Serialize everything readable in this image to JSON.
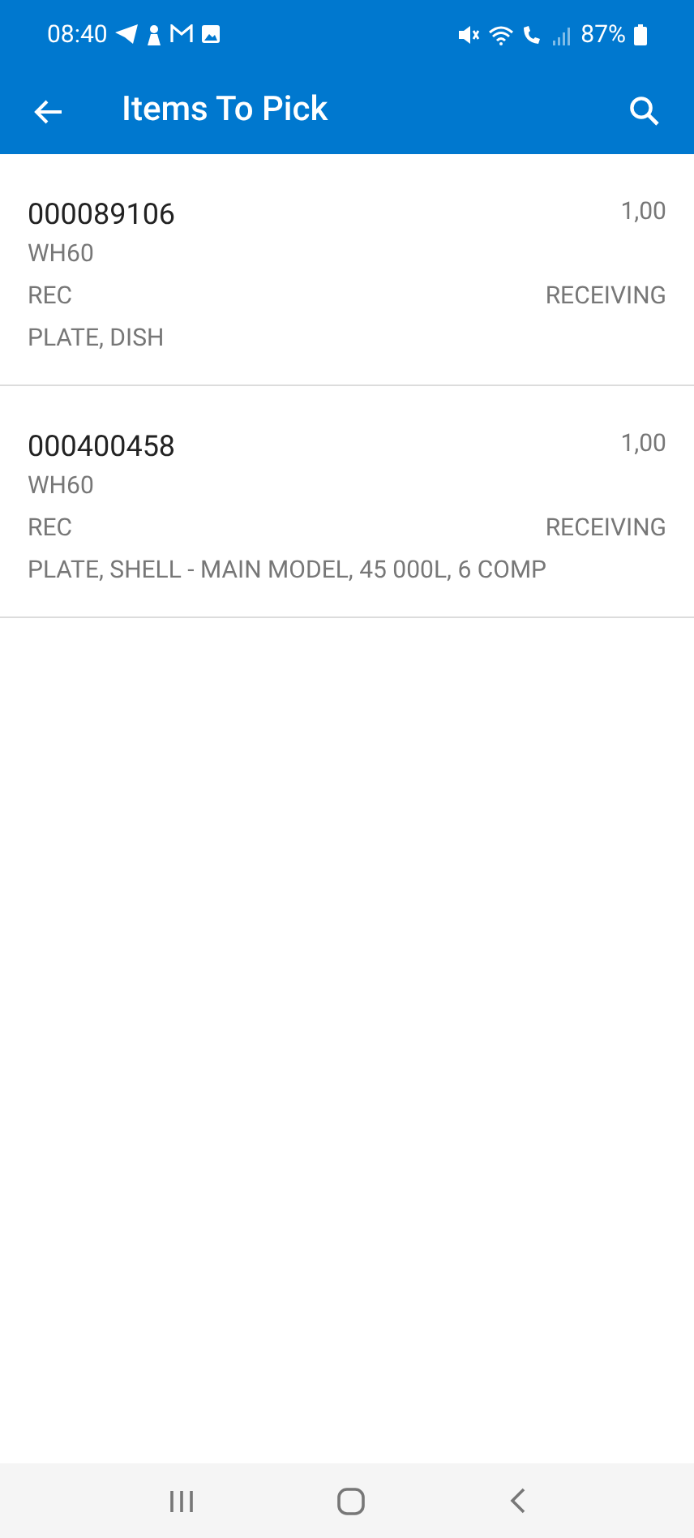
{
  "status_bar": {
    "time": "08:40",
    "battery": "87%"
  },
  "app_bar": {
    "title": "Items To Pick"
  },
  "items": [
    {
      "number": "000089106",
      "quantity": "1,00",
      "warehouse": "WH60",
      "location": "REC",
      "zone": "RECEIVING",
      "description": "PLATE, DISH"
    },
    {
      "number": "000400458",
      "quantity": "1,00",
      "warehouse": "WH60",
      "location": "REC",
      "zone": "RECEIVING",
      "description": "PLATE, SHELL - MAIN MODEL, 45 000L, 6 COMP"
    }
  ]
}
